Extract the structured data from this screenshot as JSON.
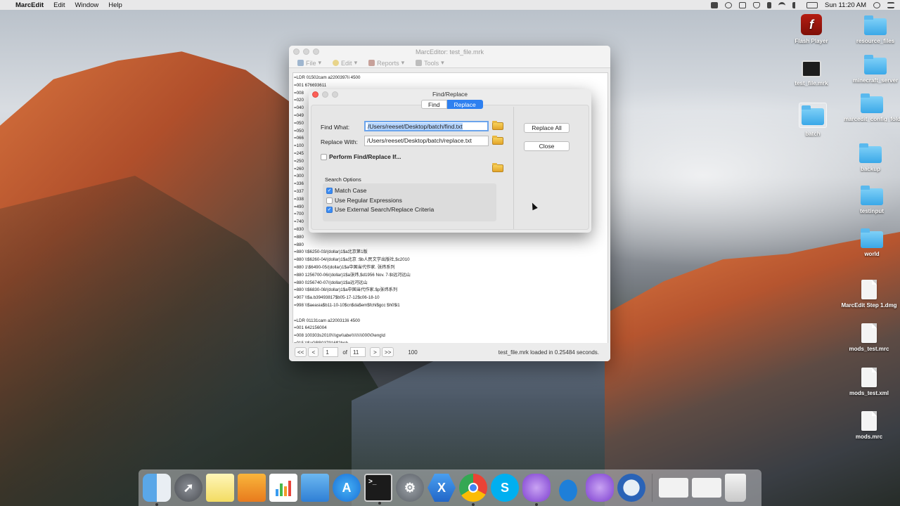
{
  "menubar": {
    "apple": "",
    "app_name": "MarcEdit",
    "items": [
      "Edit",
      "Window",
      "Help"
    ],
    "clock": "Sun 11:20 AM"
  },
  "desktop_icons": [
    {
      "label": "Flash Player",
      "kind": "app-flash"
    },
    {
      "label": "resource_files",
      "kind": "folder"
    },
    {
      "label": "test_file.mrk",
      "kind": "terminal-doc"
    },
    {
      "label": "minecraft_server",
      "kind": "folder"
    },
    {
      "label": "batch",
      "kind": "folder"
    },
    {
      "label": "marcedit_config_folder",
      "kind": "folder"
    },
    {
      "label": "backup",
      "kind": "folder"
    },
    {
      "label": "testinput",
      "kind": "folder"
    },
    {
      "label": "world",
      "kind": "folder"
    },
    {
      "label": "MarcEdit Step 1.dmg",
      "kind": "dmg"
    },
    {
      "label": "mods_test.mrc",
      "kind": "doc"
    },
    {
      "label": "mods_test.xml",
      "kind": "doc"
    },
    {
      "label": "mods.mrc",
      "kind": "doc"
    }
  ],
  "main_window": {
    "title": "MarcEditor: test_file.mrk",
    "toolbar": {
      "file": "File",
      "edit": "Edit",
      "reports": "Reports",
      "tools": "Tools"
    },
    "lines": [
      "=LDR  01502cam a2200397Ii 4500",
      "=001  676693611",
      "=008  ",
      "=020  ",
      "=040  ",
      "=049  ",
      "=050  ",
      "=050  ",
      "=066  ",
      "=100  ",
      "=245  ",
      "=250  ",
      "=260  ",
      "=300  ",
      "=336  ",
      "=337  ",
      "=338  ",
      "=490  ",
      "=700  ",
      "=740  ",
      "=830  ",
      "=880  ",
      "=880  ",
      "=880  \\\\$6250-03/(dollar)1$a北京第1版",
      "=880  \\\\$6260-04/(dollar)1$a北京 :$b人民文学出版社,$c2010",
      "=880  1\\$6490-05/(dollar)1$a中国当代作家. 张炜系列",
      "=880  1256700-06/(dollar)1$a张炜,$d1956 Nov. 7-$t远河远山",
      "=880  0256740-07/(dollar)1$a远河远山",
      "=880  \\\\$6830-08/(dollar)1$a中国当代作家.$p张炜系列",
      "=907  \\\\$a.b39493817$b05-17-12$c06-18-10",
      "=998  \\\\$aeasia$b11-10-10$cn$da$em$fchi$gcc $h0$i1",
      "",
      "=LDR  01131cam a2200313Ii 4500",
      "=001  642156004",
      "=008  100303s2010\\\\\\\\gw\\\\abe\\\\\\\\\\\\\\\\\\000\\0\\eng\\d",
      "=015  \\\\$aGBB037916$2bnb",
      "=015  \\\\$a10,N04$2dnb",
      "=020  \\\\$a9783781344393 (hbk.)",
      "=020  \\\\$a3781344390 (hbk.)",
      "=040  \\\\$aEQO$cEQO$dGEBAY$dGWDNB$dPAU$dYDXCP$dSINLB$erda$dNRC$dORU"
    ],
    "footer": {
      "first": "<<",
      "prev": "<",
      "page": "1",
      "of_label": "of",
      "total": "11",
      "next": ">",
      "last": ">>",
      "per_page": "100",
      "status": "test_file.mrk loaded in 0.25484 seconds."
    }
  },
  "dialog": {
    "title": "Find/Replace",
    "tabs": {
      "find": "Find",
      "replace": "Replace"
    },
    "find_label": "Find What:",
    "find_value": "/Users/reeset/Desktop/batch/find.txt",
    "replace_label": "Replace With:",
    "replace_value": "/Users/reeset/Desktop/batch/replace.txt",
    "perform_if_label": "Perform Find/Replace If...",
    "search_options_label": "Search Options",
    "options": {
      "match_case": {
        "label": "Match Case",
        "checked": true
      },
      "regex": {
        "label": "Use Regular Expressions",
        "checked": false
      },
      "external": {
        "label": "Use External Search/Replace Criteria",
        "checked": true
      }
    },
    "replace_all": "Replace All",
    "close": "Close"
  },
  "dock_apps": [
    "finder",
    "launchpad",
    "notes",
    "pages",
    "numbers",
    "keynote",
    "app-store",
    "terminal",
    "system-preferences",
    "xamarin",
    "chrome",
    "skype",
    "marcedit-1",
    "onedrive",
    "marcedit-2",
    "quicktime",
    "downloads-1",
    "downloads-2",
    "trash"
  ]
}
